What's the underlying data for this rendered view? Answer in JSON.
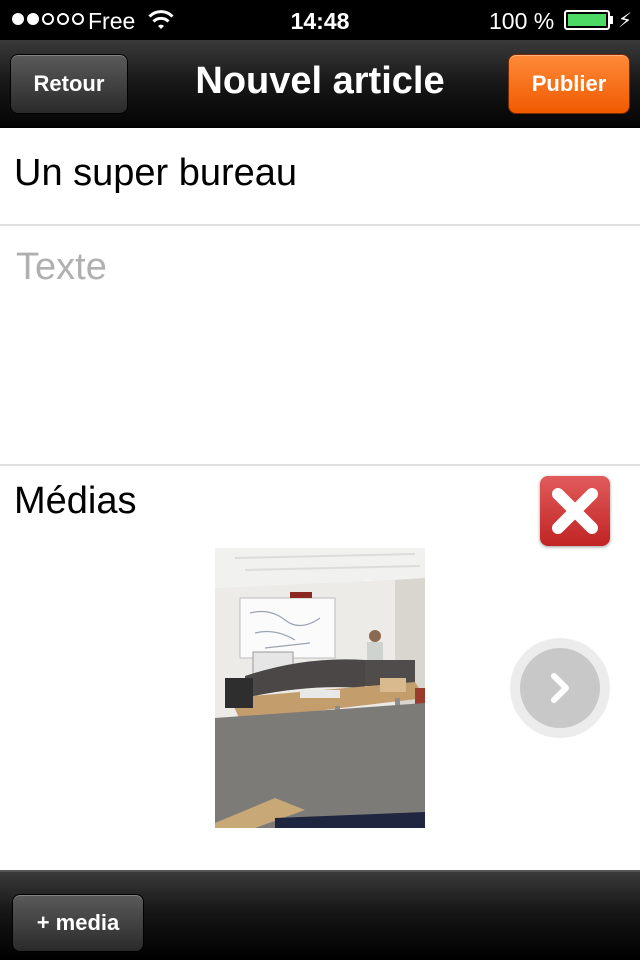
{
  "status_bar": {
    "signal_full": 2,
    "signal_total": 5,
    "carrier": "Free",
    "time": "14:48",
    "battery_percent": "100 %",
    "battery_level": 1.0,
    "battery_color": "#4cd964"
  },
  "nav": {
    "back_label": "Retour",
    "title": "Nouvel article",
    "publish_label": "Publier",
    "publish_color": "#f26a10"
  },
  "article": {
    "title_value": "Un super bureau",
    "text_placeholder": "Texte"
  },
  "media": {
    "label": "Médias",
    "delete_icon": "close-icon",
    "delete_color": "#d03a3a",
    "next_icon": "chevron-right-icon"
  },
  "toolbar": {
    "add_media_label": "+ media"
  }
}
